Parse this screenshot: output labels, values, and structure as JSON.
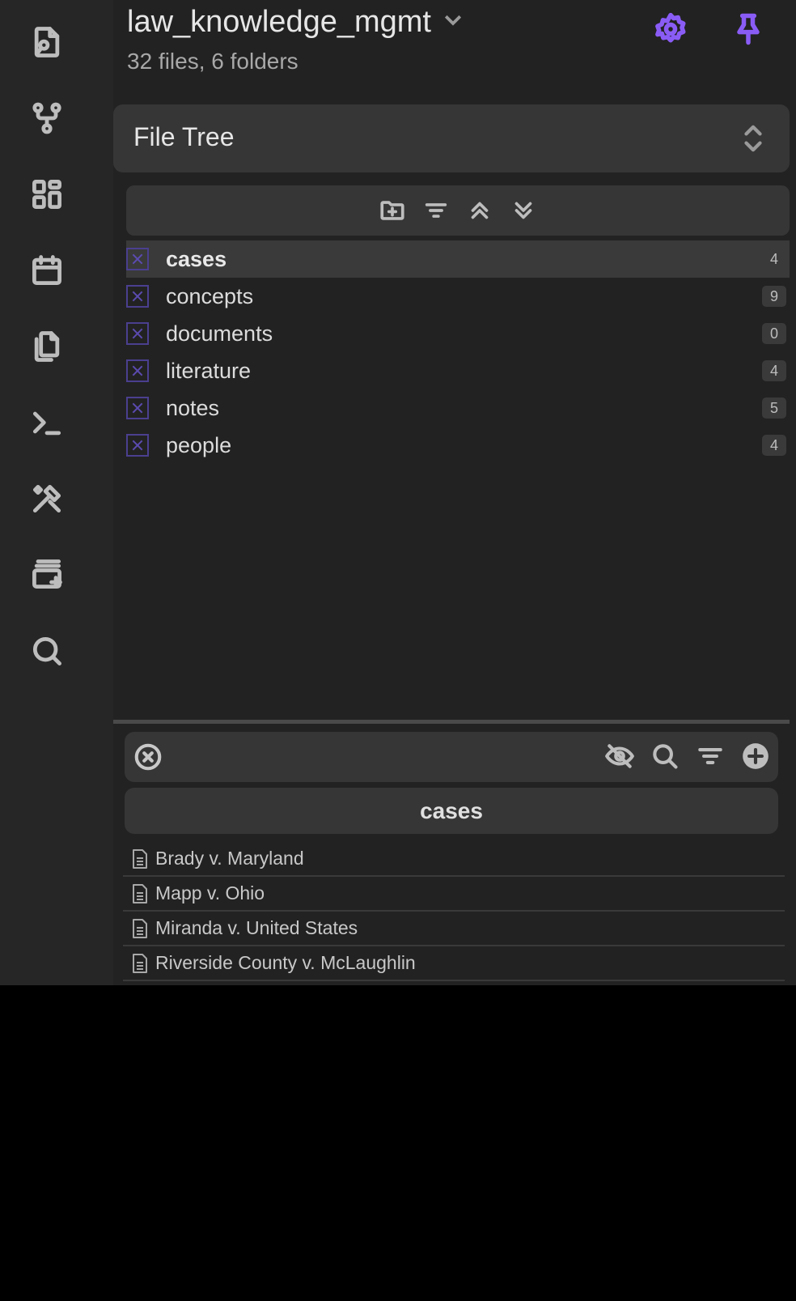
{
  "vault": {
    "name": "law_knowledge_mgmt",
    "stats": "32 files, 6 folders"
  },
  "ribbon": {
    "icons": [
      "open-file-icon",
      "graph-icon",
      "dashboard-icon",
      "calendar-icon",
      "copy-icon",
      "terminal-icon",
      "tools-icon",
      "new-card-icon",
      "search-icon"
    ]
  },
  "view_selector": {
    "label": "File Tree"
  },
  "folders": [
    {
      "name": "cases",
      "count": "4",
      "active": true
    },
    {
      "name": "concepts",
      "count": "9"
    },
    {
      "name": "documents",
      "count": "0"
    },
    {
      "name": "literature",
      "count": "4"
    },
    {
      "name": "notes",
      "count": "5"
    },
    {
      "name": "people",
      "count": "4"
    }
  ],
  "file_pane": {
    "search_placeholder": "",
    "folder_title": "cases",
    "files": [
      "Brady v. Maryland",
      "Mapp v. Ohio",
      "Miranda v. United States",
      "Riverside County v. McLaughlin"
    ]
  },
  "colors": {
    "accent": "#8a5cf6",
    "background": "#222222",
    "panel": "#363636"
  }
}
